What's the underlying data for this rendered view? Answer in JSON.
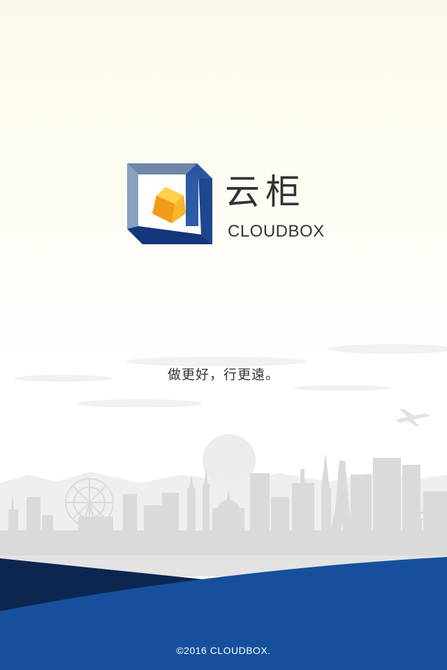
{
  "brand": {
    "name_cn": "云柜",
    "name_en": "CLOUDBOX",
    "logo_icon": "cube-in-frame-icon"
  },
  "slogan": "做更好，行更遠。",
  "footer": {
    "copyright": "©2016 CLOUDBOX."
  },
  "colors": {
    "primary_blue": "#1a4f9c",
    "dark_navy": "#0d2650",
    "cube_orange": "#f7a81b",
    "skyline_gray": "#d9d9d9",
    "text_dark": "#333333"
  }
}
